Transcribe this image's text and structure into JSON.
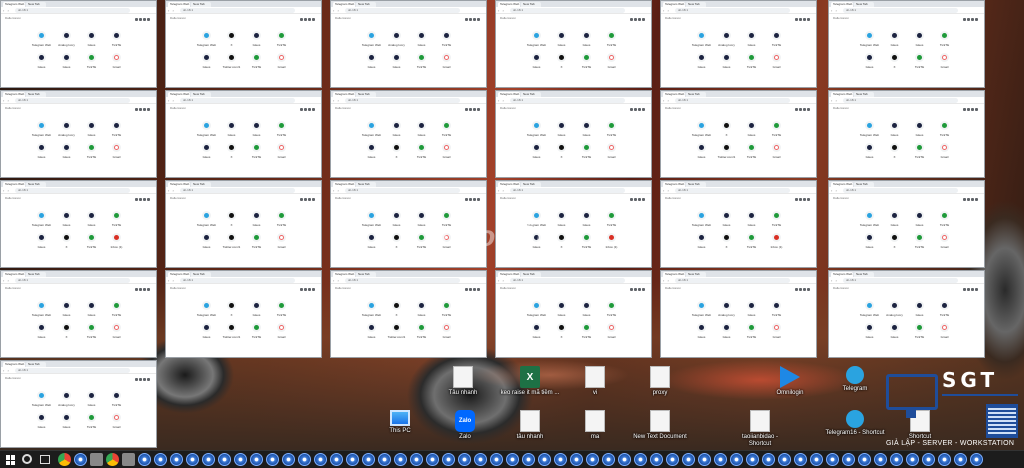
{
  "browser": {
    "tab_title": "Telegram Web",
    "new_tab_title": "New Tab",
    "address": "dc-18.1",
    "bookmark": "Dallercanon"
  },
  "shortcut_sets": {
    "A": [
      {
        "label": "Telegram Web",
        "icon": "tg"
      },
      {
        "label": "Analog Ivory",
        "icon": "gm"
      },
      {
        "label": "Gleos",
        "icon": "gm"
      },
      {
        "label": "TickTik",
        "icon": "gm"
      },
      {
        "label": "Gleos",
        "icon": "gm"
      },
      {
        "label": "Gleos",
        "icon": "gm"
      },
      {
        "label": "TickTik",
        "icon": "tt"
      },
      {
        "label": "Gmail",
        "icon": "gg"
      }
    ],
    "B": [
      {
        "label": "Telegram Web",
        "icon": "tg"
      },
      {
        "label": "Gleos",
        "icon": "gm"
      },
      {
        "label": "Gleos",
        "icon": "gm"
      },
      {
        "label": "TickTik",
        "icon": "tt"
      },
      {
        "label": "Gleos",
        "icon": "gm"
      },
      {
        "label": "X",
        "icon": "x"
      },
      {
        "label": "TickTik",
        "icon": "tt"
      },
      {
        "label": "Gmail",
        "icon": "gg"
      }
    ],
    "C": [
      {
        "label": "Telegram Web",
        "icon": "tg"
      },
      {
        "label": "Gleos",
        "icon": "gm"
      },
      {
        "label": "Gleos",
        "icon": "gm"
      },
      {
        "label": "TickTik",
        "icon": "tt"
      },
      {
        "label": "Gleos",
        "icon": "gm"
      },
      {
        "label": "X",
        "icon": "x"
      },
      {
        "label": "TickTik",
        "icon": "tt"
      },
      {
        "label": "Inbox (1)",
        "icon": "gml"
      }
    ],
    "D": [
      {
        "label": "Telegram Web",
        "icon": "tg"
      },
      {
        "label": "X",
        "icon": "x"
      },
      {
        "label": "Gleos",
        "icon": "gm"
      },
      {
        "label": "TickTik",
        "icon": "tt"
      },
      {
        "label": "Gleos",
        "icon": "gm"
      },
      {
        "label": "Twitter.com/1",
        "icon": "x"
      },
      {
        "label": "TickTik",
        "icon": "tt"
      },
      {
        "label": "Gmail",
        "icon": "gg"
      }
    ]
  },
  "watermark": "choTốt",
  "desktop_icons": [
    {
      "label": "Tâu nhanh",
      "icon": "file"
    },
    {
      "label": "keo raise it mã tiềm ...",
      "icon": "excel"
    },
    {
      "label": "vi",
      "icon": "file"
    },
    {
      "label": "proxy",
      "icon": "file"
    },
    {
      "label": "Omnilogin",
      "icon": "omni"
    },
    {
      "label": "Telegram",
      "icon": "tg"
    },
    {
      "label": "This PC",
      "icon": "pc"
    },
    {
      "label": "Zalo",
      "icon": "zalo"
    },
    {
      "label": "tâu nhanh",
      "icon": "file"
    },
    {
      "label": "ma",
      "icon": "file"
    },
    {
      "label": "New Text Document",
      "icon": "file"
    },
    {
      "label": "taoiianbidao - Shortcut",
      "icon": "file"
    },
    {
      "label": "Telegram16 - Shortcut",
      "icon": "tg"
    },
    {
      "label": "Shortcut",
      "icon": "file"
    }
  ],
  "logo": {
    "name": "SGT",
    "tagline": "GIẢ LẬP - SERVER - WORKSTATION",
    "color": "#1f4d9a"
  },
  "taskbar": {
    "background": "#1c1c1c"
  }
}
